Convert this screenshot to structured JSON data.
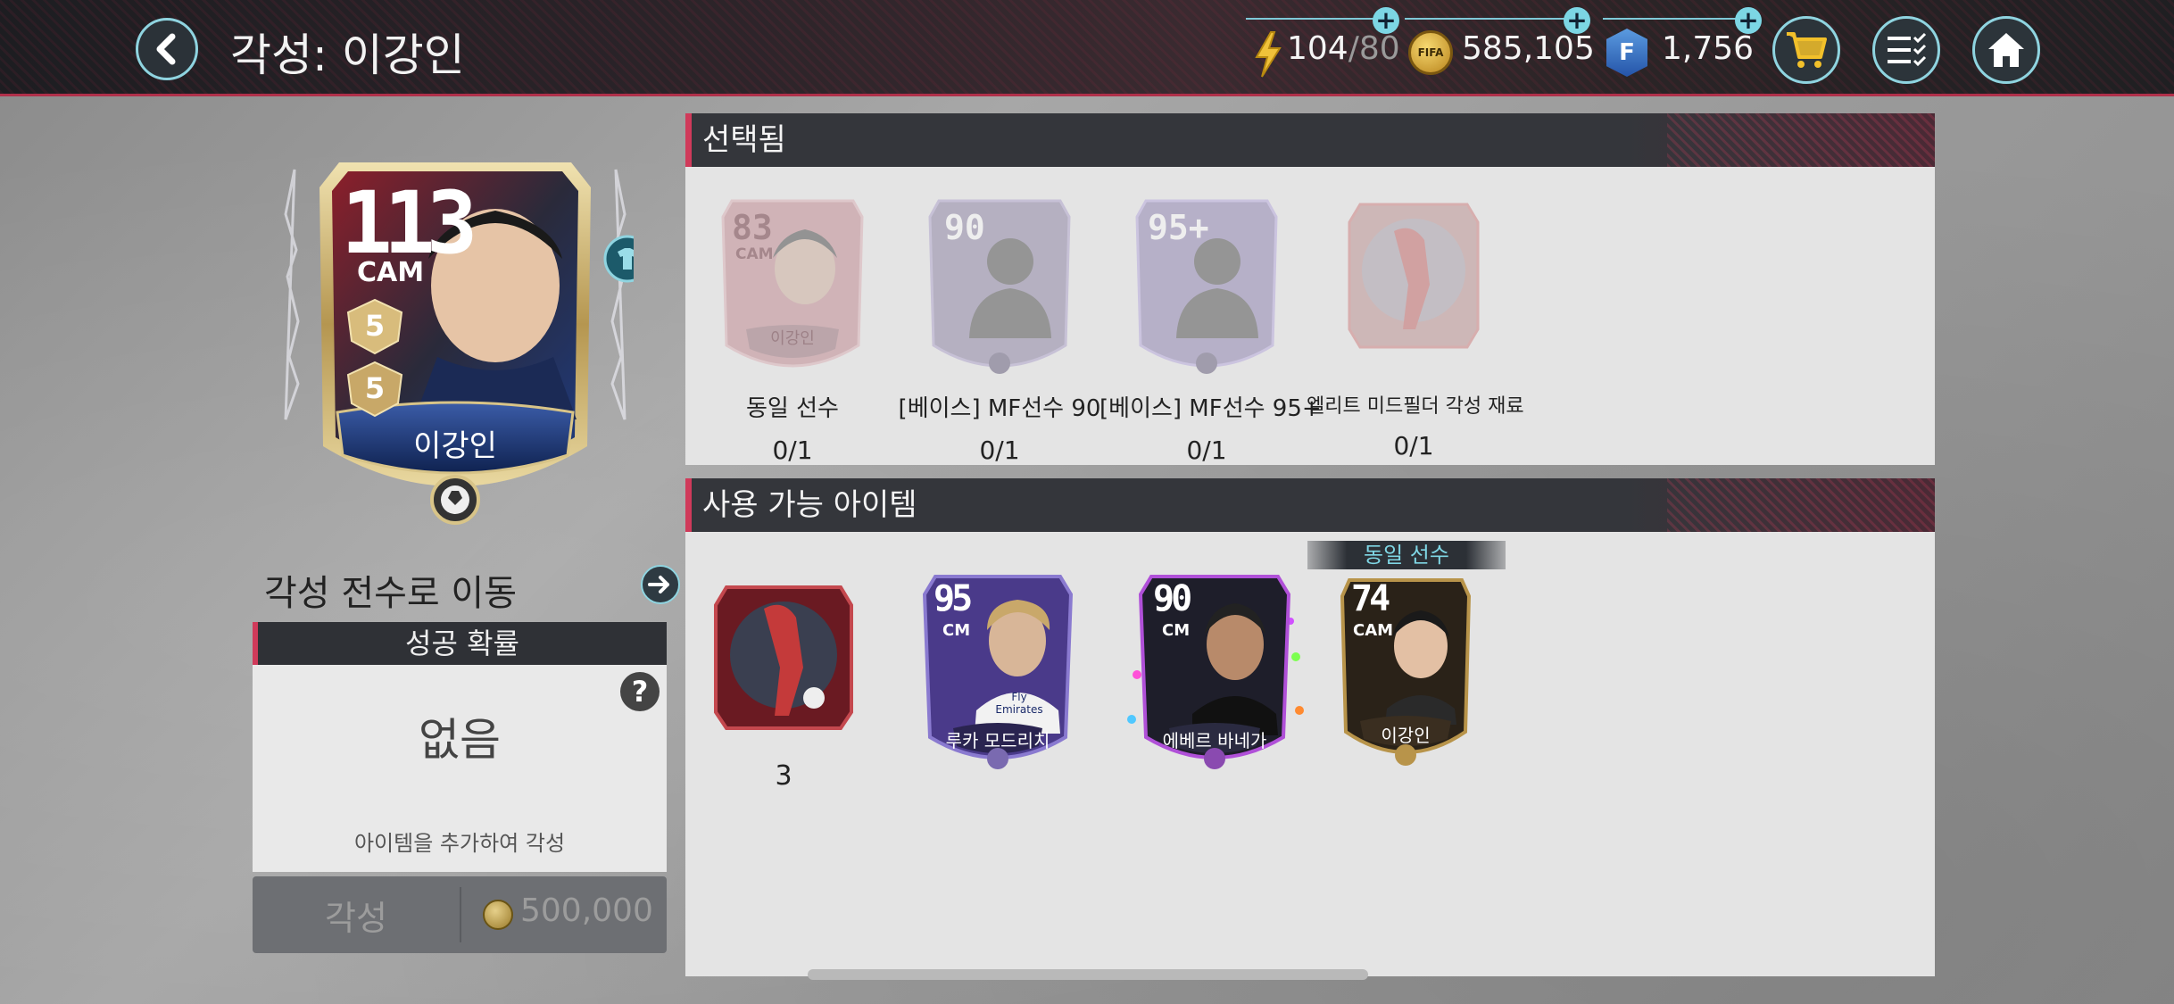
{
  "header": {
    "title": "각성: 이강인",
    "stamina": {
      "current": "104",
      "max": "/80"
    },
    "coins": "585,105",
    "fifa_points": "1,756",
    "coin_icon_text": "FIFA",
    "fp_icon_text": "F"
  },
  "player_card": {
    "ovr": "113",
    "position": "CAM",
    "rank_top": "5",
    "rank_bottom": "5",
    "name": "이강인"
  },
  "goto_label": "각성 전수로 이동",
  "probability": {
    "header": "성공 확률",
    "help": "?",
    "value": "없음",
    "hint": "아이템을 추가하여 각성"
  },
  "awaken_button": {
    "label": "각성",
    "cost": "500,000"
  },
  "selected": {
    "title": "선택됨",
    "slots": [
      {
        "label": "동일 선수",
        "count": "0/1",
        "ovr": "83",
        "pos": "CAM",
        "name": "이강인"
      },
      {
        "label": "[베이스] MF선수 90",
        "count": "0/1",
        "ovr": "90"
      },
      {
        "label": "[베이스] MF선수 95+",
        "count": "0/1",
        "ovr": "95+"
      },
      {
        "label": "엘리트 미드필더 각성 재료",
        "count": "0/1"
      }
    ]
  },
  "available": {
    "title": "사용 가능 아이템",
    "badge": "동일 선수",
    "items": [
      {
        "type": "material",
        "count": "3"
      },
      {
        "ovr": "95",
        "pos": "CM",
        "name": "루카 모드리치",
        "kit_text": "Fly Emirates"
      },
      {
        "ovr": "90",
        "pos": "CM",
        "name": "에베르 바네가"
      },
      {
        "ovr": "74",
        "pos": "CAM",
        "name": "이강인"
      }
    ]
  }
}
